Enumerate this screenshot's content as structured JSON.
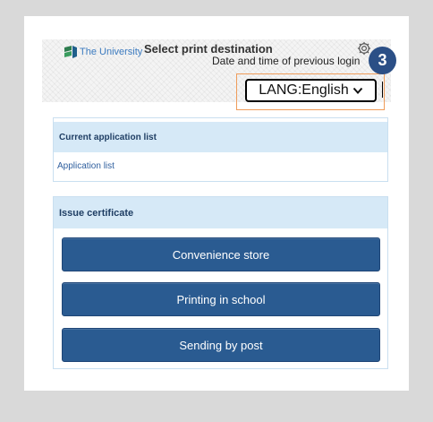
{
  "header": {
    "logo_text": "The University",
    "page_title": "Select print destination",
    "last_login_label": "Date and time of previous login",
    "language_select_value": "LANG:English"
  },
  "annotation": {
    "step_number": "3",
    "step_color": "#2b4f86",
    "highlight_color": "#ef9c5a"
  },
  "current_applications": {
    "heading": "Current application list",
    "link": "Application list"
  },
  "issue_certificate": {
    "heading": "Issue certificate",
    "buttons": [
      "Convenience store",
      "Printing in school",
      "Sending by post"
    ]
  },
  "icons": {
    "logo": "university-logo-icon",
    "settings": "gear-icon",
    "dropdown": "chevron-down-icon"
  }
}
